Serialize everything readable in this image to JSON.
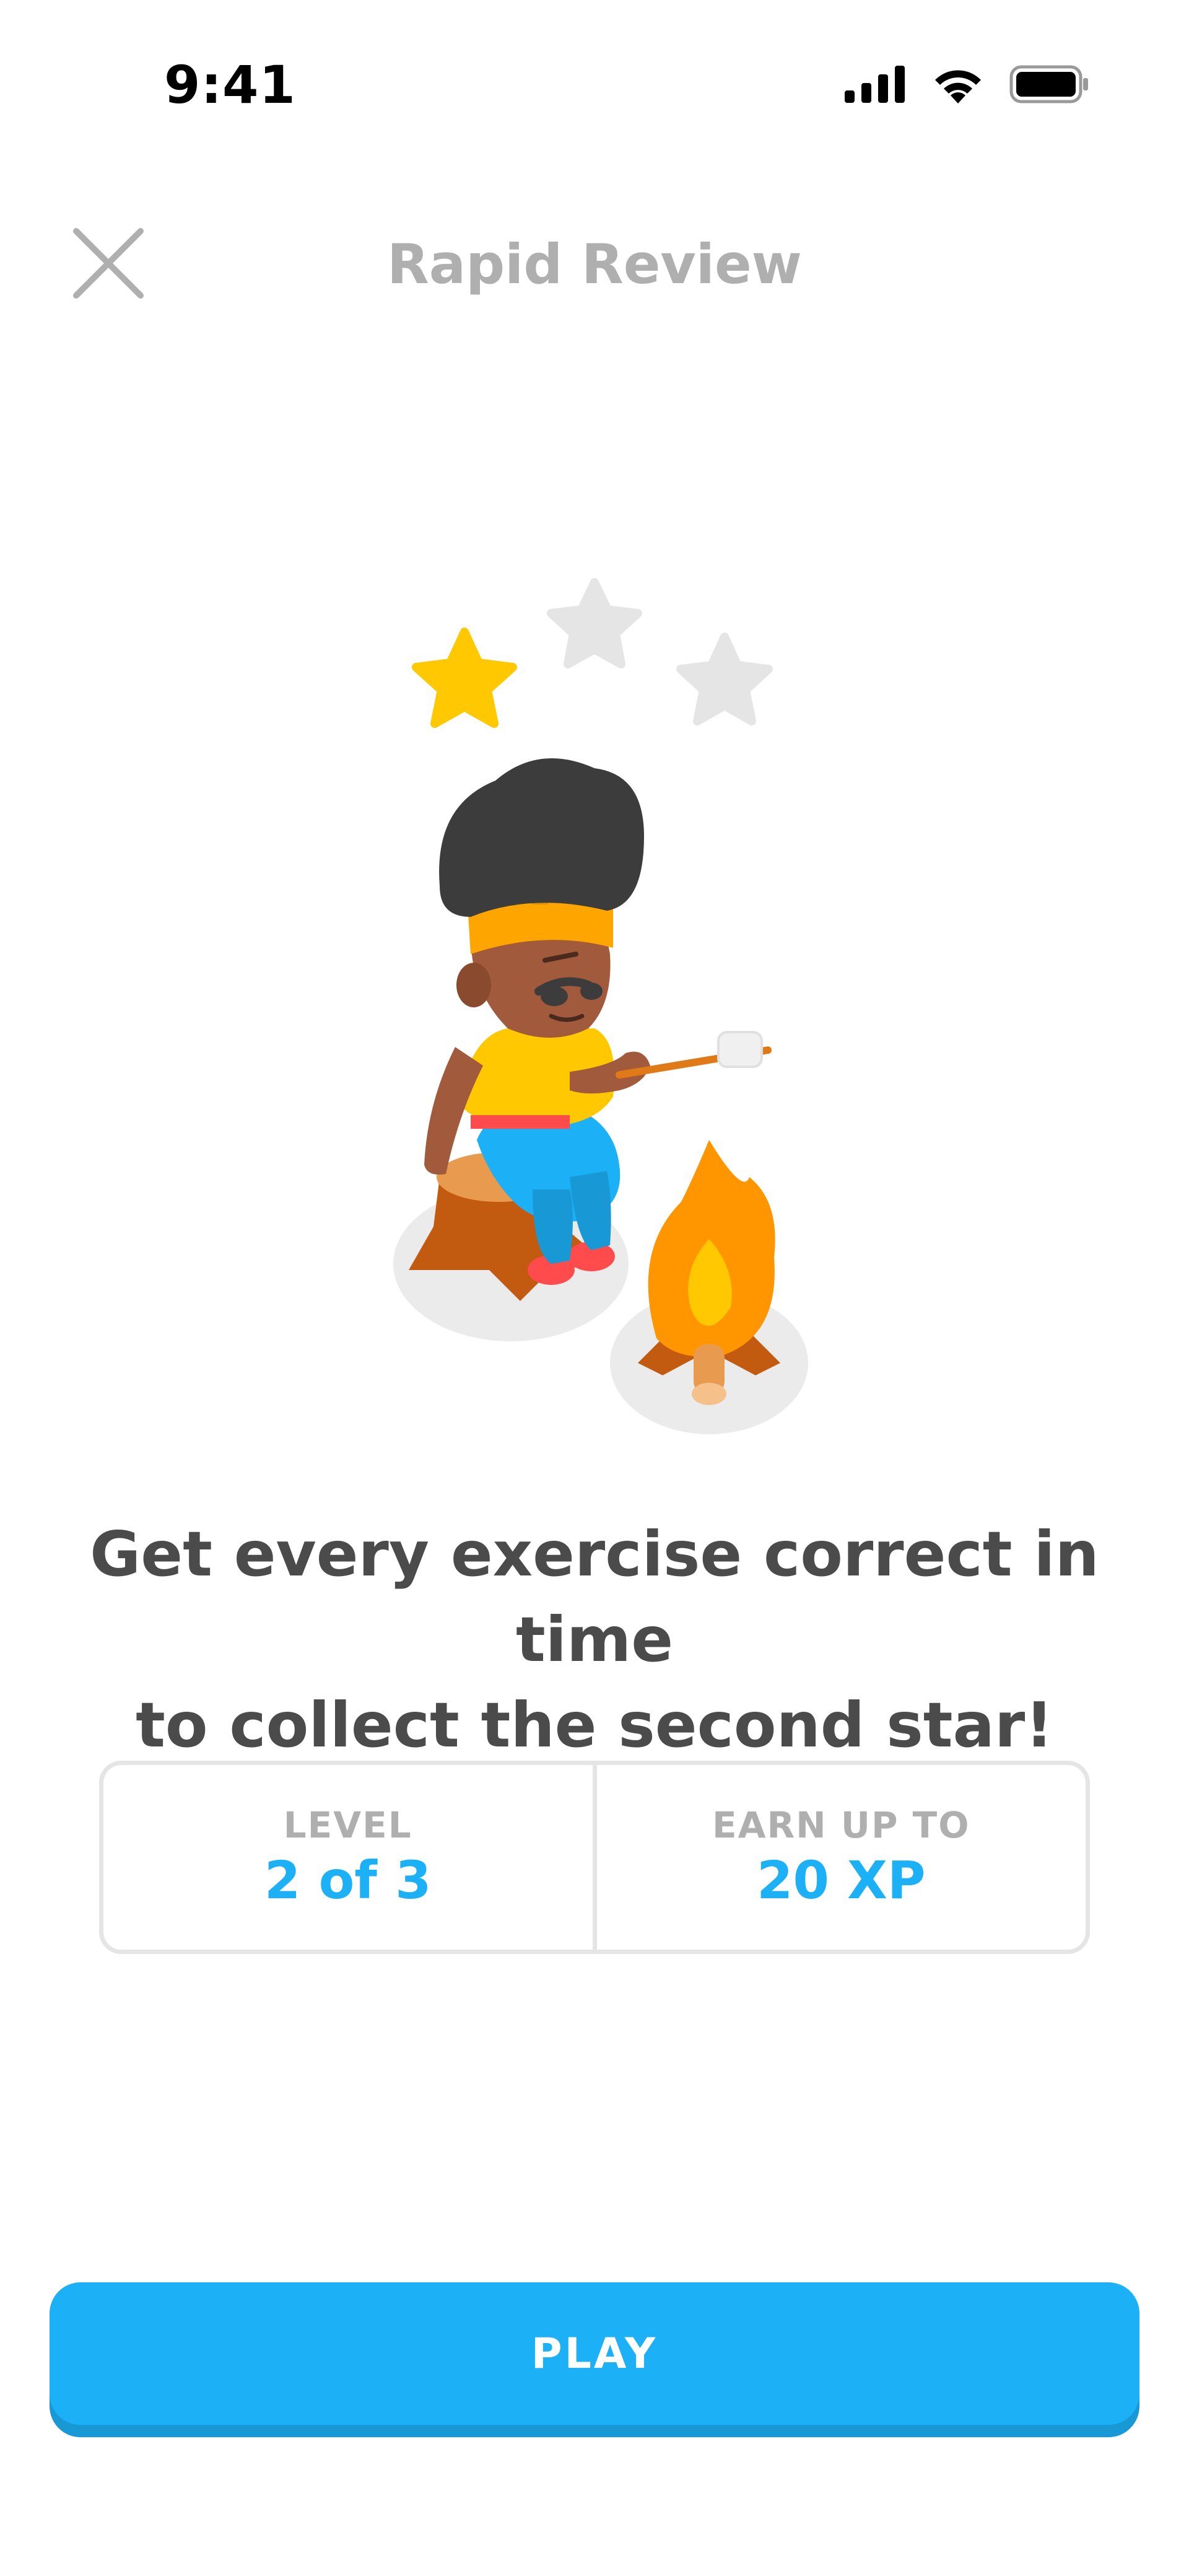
{
  "status_bar": {
    "time": "9:41",
    "icons": [
      "signal-icon",
      "wifi-icon",
      "battery-icon"
    ]
  },
  "header": {
    "close_icon": "close-icon",
    "title": "Rapid Review"
  },
  "illustration": {
    "stars_total": 3,
    "stars_filled": 1,
    "subject": "character roasting marshmallow by campfire"
  },
  "prompt": {
    "line1": "Get every exercise correct in time",
    "line2": "to collect the second star!"
  },
  "info": {
    "level_label": "LEVEL",
    "level_value": "2 of 3",
    "xp_label": "EARN UP TO",
    "xp_value": "20 XP"
  },
  "actions": {
    "play_label": "PLAY"
  },
  "colors": {
    "accent": "#1cb0f6",
    "accent_shadow": "#1899d6",
    "muted_text": "#afafaf",
    "body_text": "#4b4b4b",
    "border": "#e5e5e5",
    "star_gold": "#ffc800",
    "star_empty": "#e5e5e5"
  }
}
